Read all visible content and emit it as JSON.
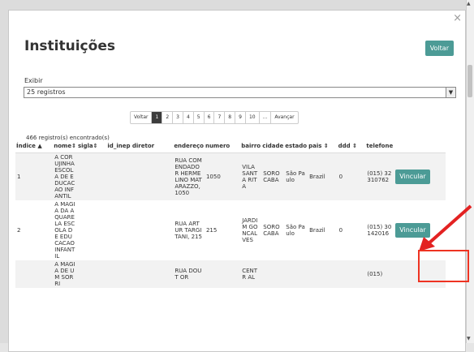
{
  "modal": {
    "title": "Instituições",
    "voltar_label": "Voltar",
    "exibir_label": "Exibir",
    "select_value": "25 registros",
    "count_text": "466 registro(s) encontrado(s)"
  },
  "pager": [
    "Voltar",
    "1",
    "2",
    "3",
    "4",
    "5",
    "6",
    "7",
    "8",
    "9",
    "10",
    "...",
    "Avançar"
  ],
  "table": {
    "headers": [
      "Índice ▲",
      "nome⇕",
      "sigla⇕",
      "id_inep diretor",
      "endereço",
      "numero",
      "bairro",
      "cidade",
      "estado",
      "pais ⇕",
      "ddd ⇕",
      "telefone"
    ],
    "rows": [
      {
        "indice": "1",
        "nome": "A CORUJINHA ESCOLA DE EDUCACAO INFANTIL",
        "endereco": "RUA COMENDADOR HERMELINO MATARAZZO, 1050",
        "numero": "1050",
        "bairro": "VILA SANTA RITA",
        "cidade": "SOROCABA",
        "estado": "São Paulo",
        "pais": "Brazil",
        "ddd": "0",
        "telefone": "(015) 32310762",
        "acao": "Vincular"
      },
      {
        "indice": "2",
        "nome": "A MAGIA DA AQUARELA ESCOLA DE EDUCACAO INFANTIL",
        "endereco": "RUA ARTUR TARGITANI, 215",
        "numero": "215",
        "bairro": "JARDIM GONCALVES",
        "cidade": "SOROCABA",
        "estado": "São Paulo",
        "pais": "Brazil",
        "ddd": "0",
        "telefone": "(015) 30142016",
        "acao": "Vincular"
      },
      {
        "indice": "",
        "nome": "A MAGIA DE UM SORRI",
        "endereco": "RUA DOUT OR",
        "numero": "",
        "bairro": "CENTR AL",
        "cidade": "",
        "estado": "",
        "pais": "",
        "ddd": "",
        "telefone": "(015)",
        "acao": ""
      }
    ]
  },
  "colors": {
    "accent": "#4c9b96",
    "annotation": "#e32222"
  }
}
